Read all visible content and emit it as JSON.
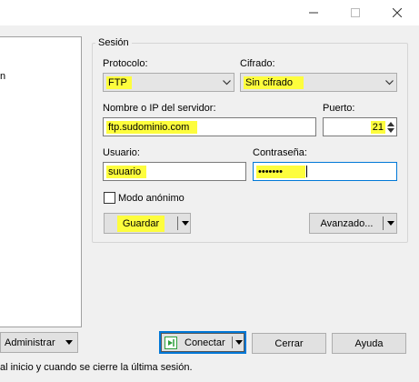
{
  "window": {
    "minimize_icon": "minimize-icon",
    "maximize_icon": "maximize-icon",
    "close_icon": "close-icon"
  },
  "left": {
    "partial_text": "n"
  },
  "session": {
    "group_title": "Sesión",
    "protocol_label": "Protocolo:",
    "protocol_value": "FTP",
    "encryption_label": "Cifrado:",
    "encryption_value": "Sin cifrado",
    "host_label": "Nombre o IP del servidor:",
    "host_value": "ftp.sudominio.com",
    "port_label": "Puerto:",
    "port_value": "21",
    "user_label": "Usuario:",
    "user_value": "suuario",
    "password_label": "Contraseña:",
    "password_value": "•••••••",
    "anonymous_label": "Modo anónimo",
    "anonymous_checked": false,
    "save_label": "Guardar",
    "advanced_label": "Avanzado..."
  },
  "footer": {
    "manage_label": "Administrar",
    "connect_label": "Conectar",
    "close_label": "Cerrar",
    "help_label": "Ayuda",
    "status_text": "al inicio y cuando se cierre la última sesión."
  },
  "colors": {
    "highlight": "#fdfd3d",
    "connect_icon": "#2e9e3a",
    "default_ring": "#0078d7"
  }
}
